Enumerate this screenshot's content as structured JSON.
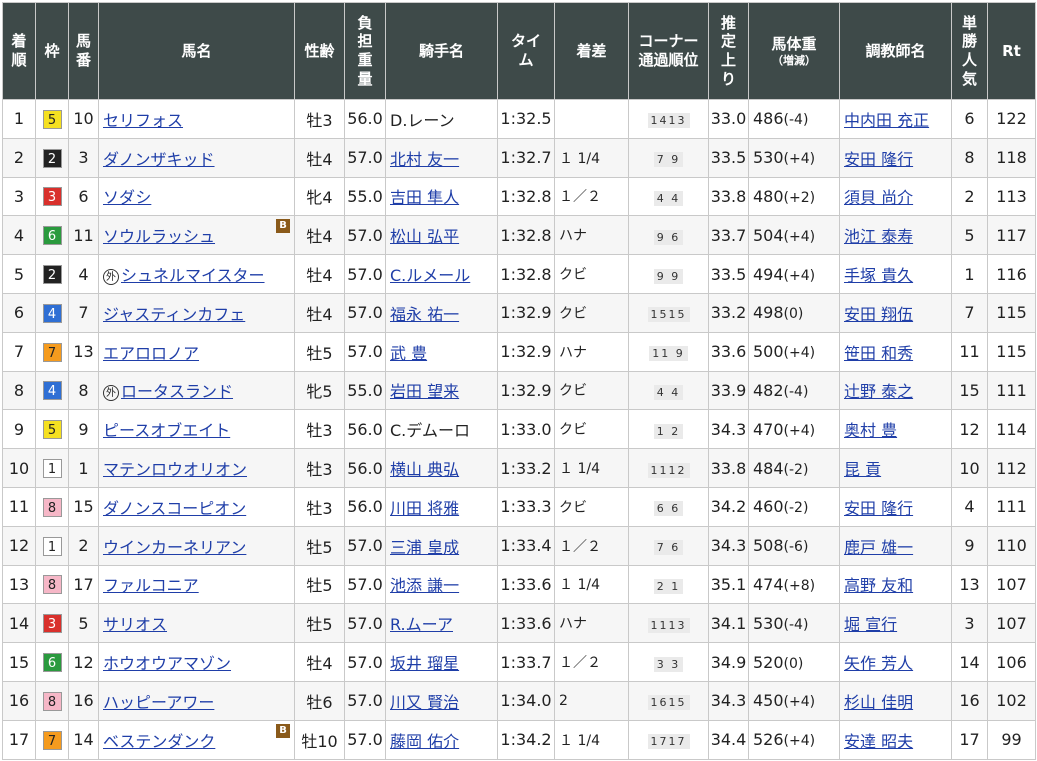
{
  "headers": {
    "rank": [
      "着",
      "順"
    ],
    "waku": "枠",
    "umaban": [
      "馬",
      "番"
    ],
    "name": "馬名",
    "sexage": "性齢",
    "weight": [
      "負",
      "担",
      "重",
      "量"
    ],
    "jockey": "騎手名",
    "time": [
      "タイ",
      "ム"
    ],
    "margin": "着差",
    "corner": [
      "コーナー",
      "通過順位"
    ],
    "last3f": [
      "推",
      "定",
      "上",
      "り"
    ],
    "bodyweight": "馬体重",
    "bodyweight_sub": "（増減）",
    "trainer": "調教師名",
    "pop": [
      "単",
      "勝",
      "人",
      "気"
    ],
    "rt": "Rt"
  },
  "marks": {
    "foreign": "外",
    "blinker": "B"
  },
  "waku_colors": {
    "1": {
      "bg": "#ffffff",
      "fg": "#222222"
    },
    "2": {
      "bg": "#222222",
      "fg": "#ffffff"
    },
    "3": {
      "bg": "#d9302c",
      "fg": "#ffffff"
    },
    "4": {
      "bg": "#2f6fd4",
      "fg": "#ffffff"
    },
    "5": {
      "bg": "#f5e021",
      "fg": "#222222"
    },
    "6": {
      "bg": "#2a9a3e",
      "fg": "#ffffff"
    },
    "7": {
      "bg": "#f59b1e",
      "fg": "#222222"
    },
    "8": {
      "bg": "#f6b7c7",
      "fg": "#222222"
    }
  },
  "rows": [
    {
      "rank": "1",
      "waku": "5",
      "umaban": "10",
      "foreign": false,
      "name": "セリフォス",
      "blinker": false,
      "sexage": "牡3",
      "weight": "56.0",
      "jockey": "D.レーン",
      "jockey_link": false,
      "time": "1:32.5",
      "margin": "",
      "corner": "1413",
      "last3f": "33.0",
      "bw": "486",
      "bwd": "(-4)",
      "trainer": "中内田 充正",
      "pop": "6",
      "rt": "122"
    },
    {
      "rank": "2",
      "waku": "2",
      "umaban": "3",
      "foreign": false,
      "name": "ダノンザキッド",
      "blinker": false,
      "sexage": "牡4",
      "weight": "57.0",
      "jockey": "北村 友一",
      "jockey_link": true,
      "time": "1:32.7",
      "margin": "１ 1/4",
      "corner": "7 9",
      "last3f": "33.5",
      "bw": "530",
      "bwd": "(+4)",
      "trainer": "安田 隆行",
      "pop": "8",
      "rt": "118"
    },
    {
      "rank": "3",
      "waku": "3",
      "umaban": "6",
      "foreign": false,
      "name": "ソダシ",
      "blinker": false,
      "sexage": "牝4",
      "weight": "55.0",
      "jockey": "吉田 隼人",
      "jockey_link": true,
      "time": "1:32.8",
      "margin": "１／２",
      "corner": "4 4",
      "last3f": "33.8",
      "bw": "480",
      "bwd": "(+2)",
      "trainer": "須貝 尚介",
      "pop": "2",
      "rt": "113"
    },
    {
      "rank": "4",
      "waku": "6",
      "umaban": "11",
      "foreign": false,
      "name": "ソウルラッシュ",
      "blinker": true,
      "sexage": "牡4",
      "weight": "57.0",
      "jockey": "松山 弘平",
      "jockey_link": true,
      "time": "1:32.8",
      "margin": "ハナ",
      "corner": "9 6",
      "last3f": "33.7",
      "bw": "504",
      "bwd": "(+4)",
      "trainer": "池江 泰寿",
      "pop": "5",
      "rt": "117"
    },
    {
      "rank": "5",
      "waku": "2",
      "umaban": "4",
      "foreign": true,
      "name": "シュネルマイスター",
      "blinker": false,
      "sexage": "牡4",
      "weight": "57.0",
      "jockey": "C.ルメール",
      "jockey_link": true,
      "time": "1:32.8",
      "margin": "クビ",
      "corner": "9 9",
      "last3f": "33.5",
      "bw": "494",
      "bwd": "(+4)",
      "trainer": "手塚 貴久",
      "pop": "1",
      "rt": "116"
    },
    {
      "rank": "6",
      "waku": "4",
      "umaban": "7",
      "foreign": false,
      "name": "ジャスティンカフェ",
      "blinker": false,
      "sexage": "牡4",
      "weight": "57.0",
      "jockey": "福永 祐一",
      "jockey_link": true,
      "time": "1:32.9",
      "margin": "クビ",
      "corner": "1515",
      "last3f": "33.2",
      "bw": "498",
      "bwd": "(0)",
      "trainer": "安田 翔伍",
      "pop": "7",
      "rt": "115"
    },
    {
      "rank": "7",
      "waku": "7",
      "umaban": "13",
      "foreign": false,
      "name": "エアロロノア",
      "blinker": false,
      "sexage": "牡5",
      "weight": "57.0",
      "jockey": "武 豊",
      "jockey_link": true,
      "time": "1:32.9",
      "margin": "ハナ",
      "corner": "11 9",
      "last3f": "33.6",
      "bw": "500",
      "bwd": "(+4)",
      "trainer": "笹田 和秀",
      "pop": "11",
      "rt": "115"
    },
    {
      "rank": "8",
      "waku": "4",
      "umaban": "8",
      "foreign": true,
      "name": "ロータスランド",
      "blinker": false,
      "sexage": "牝5",
      "weight": "55.0",
      "jockey": "岩田 望来",
      "jockey_link": true,
      "time": "1:32.9",
      "margin": "クビ",
      "corner": "4 4",
      "last3f": "33.9",
      "bw": "482",
      "bwd": "(-4)",
      "trainer": "辻野 泰之",
      "pop": "15",
      "rt": "111"
    },
    {
      "rank": "9",
      "waku": "5",
      "umaban": "9",
      "foreign": false,
      "name": "ピースオブエイト",
      "blinker": false,
      "sexage": "牡3",
      "weight": "56.0",
      "jockey": "C.デムーロ",
      "jockey_link": false,
      "time": "1:33.0",
      "margin": "クビ",
      "corner": "1 2",
      "last3f": "34.3",
      "bw": "470",
      "bwd": "(+4)",
      "trainer": "奥村 豊",
      "pop": "12",
      "rt": "114"
    },
    {
      "rank": "10",
      "waku": "1",
      "umaban": "1",
      "foreign": false,
      "name": "マテンロウオリオン",
      "blinker": false,
      "sexage": "牡3",
      "weight": "56.0",
      "jockey": "横山 典弘",
      "jockey_link": true,
      "time": "1:33.2",
      "margin": "１ 1/4",
      "corner": "1112",
      "last3f": "33.8",
      "bw": "484",
      "bwd": "(-2)",
      "trainer": "昆 貢",
      "pop": "10",
      "rt": "112"
    },
    {
      "rank": "11",
      "waku": "8",
      "umaban": "15",
      "foreign": false,
      "name": "ダノンスコーピオン",
      "blinker": false,
      "sexage": "牡3",
      "weight": "56.0",
      "jockey": "川田 将雅",
      "jockey_link": true,
      "time": "1:33.3",
      "margin": "クビ",
      "corner": "6 6",
      "last3f": "34.2",
      "bw": "460",
      "bwd": "(-2)",
      "trainer": "安田 隆行",
      "pop": "4",
      "rt": "111"
    },
    {
      "rank": "12",
      "waku": "1",
      "umaban": "2",
      "foreign": false,
      "name": "ウインカーネリアン",
      "blinker": false,
      "sexage": "牡5",
      "weight": "57.0",
      "jockey": "三浦 皇成",
      "jockey_link": true,
      "time": "1:33.4",
      "margin": "１／２",
      "corner": "7 6",
      "last3f": "34.3",
      "bw": "508",
      "bwd": "(-6)",
      "trainer": "鹿戸 雄一",
      "pop": "9",
      "rt": "110"
    },
    {
      "rank": "13",
      "waku": "8",
      "umaban": "17",
      "foreign": false,
      "name": "ファルコニア",
      "blinker": false,
      "sexage": "牡5",
      "weight": "57.0",
      "jockey": "池添 謙一",
      "jockey_link": true,
      "time": "1:33.6",
      "margin": "１ 1/4",
      "corner": "2 1",
      "last3f": "35.1",
      "bw": "474",
      "bwd": "(+8)",
      "trainer": "高野 友和",
      "pop": "13",
      "rt": "107"
    },
    {
      "rank": "14",
      "waku": "3",
      "umaban": "5",
      "foreign": false,
      "name": "サリオス",
      "blinker": false,
      "sexage": "牡5",
      "weight": "57.0",
      "jockey": "R.ムーア",
      "jockey_link": true,
      "time": "1:33.6",
      "margin": "ハナ",
      "corner": "1113",
      "last3f": "34.1",
      "bw": "530",
      "bwd": "(-4)",
      "trainer": "堀 宣行",
      "pop": "3",
      "rt": "107"
    },
    {
      "rank": "15",
      "waku": "6",
      "umaban": "12",
      "foreign": false,
      "name": "ホウオウアマゾン",
      "blinker": false,
      "sexage": "牡4",
      "weight": "57.0",
      "jockey": "坂井 瑠星",
      "jockey_link": true,
      "time": "1:33.7",
      "margin": "１／２",
      "corner": "3 3",
      "last3f": "34.9",
      "bw": "520",
      "bwd": "(0)",
      "trainer": "矢作 芳人",
      "pop": "14",
      "rt": "106"
    },
    {
      "rank": "16",
      "waku": "8",
      "umaban": "16",
      "foreign": false,
      "name": "ハッピーアワー",
      "blinker": false,
      "sexage": "牡6",
      "weight": "57.0",
      "jockey": "川又 賢治",
      "jockey_link": true,
      "time": "1:34.0",
      "margin": "2",
      "corner": "1615",
      "last3f": "34.3",
      "bw": "450",
      "bwd": "(+4)",
      "trainer": "杉山 佳明",
      "pop": "16",
      "rt": "102"
    },
    {
      "rank": "17",
      "waku": "7",
      "umaban": "14",
      "foreign": false,
      "name": "ベステンダンク",
      "blinker": true,
      "sexage": "牡10",
      "weight": "57.0",
      "jockey": "藤岡 佑介",
      "jockey_link": true,
      "time": "1:34.2",
      "margin": "１ 1/4",
      "corner": "1717",
      "last3f": "34.4",
      "bw": "526",
      "bwd": "(+4)",
      "trainer": "安達 昭夫",
      "pop": "17",
      "rt": "99"
    }
  ]
}
